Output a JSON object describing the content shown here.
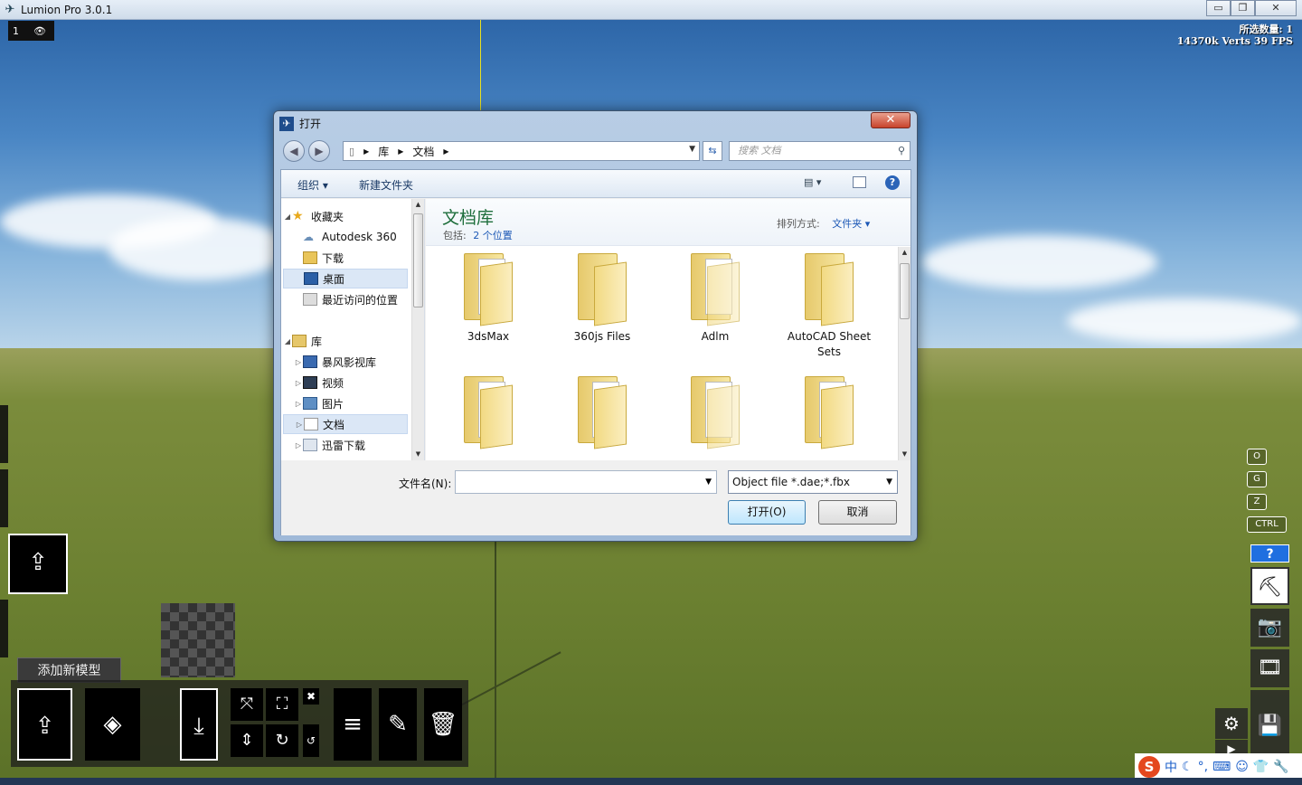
{
  "app": {
    "title": "Lumion Pro  3.0.1",
    "window_buttons": [
      "▭",
      "❐",
      "✕"
    ]
  },
  "viewport": {
    "layer_number": "1",
    "stats_line1": "所选数量: 1",
    "stats_line2": "14370k Verts 39 FPS"
  },
  "dialog": {
    "title": "打开",
    "close_label": "✕",
    "address": {
      "crumbs": [
        "库",
        "文档"
      ]
    },
    "search_placeholder": "搜索 文档",
    "toolbar": {
      "organize": "组织 ▾",
      "new_folder": "新建文件夹"
    },
    "nav": {
      "favorites": "收藏夹",
      "items_fav": [
        "Autodesk 360",
        "下载",
        "桌面",
        "最近访问的位置"
      ],
      "library": "库",
      "items_lib": [
        "暴风影视库",
        "视频",
        "图片",
        "文档",
        "迅雷下载"
      ]
    },
    "library_title": "文档库",
    "includes_label": "包括:",
    "includes_value": "2 个位置",
    "sort_label": "排列方式:",
    "sort_value": "文件夹 ▾",
    "folders": [
      "3dsMax",
      "360js Files",
      "Adlm",
      "AutoCAD Sheet Sets"
    ],
    "filename_label": "文件名(N):",
    "filename_value": "",
    "filetype_value": "Object file *.dae;*.fbx",
    "open_button": "打开(O)",
    "cancel_button": "取消"
  },
  "lumion": {
    "tooltip": "添加新模型",
    "key_hints": [
      "O",
      "G",
      "Z",
      "CTRL"
    ],
    "help": "?"
  },
  "ime": {
    "logo": "S",
    "mode": "中"
  },
  "colors": {
    "accent": "#1c58b6",
    "library_title": "#1e6e3c",
    "help_blue": "#1f6fe0"
  }
}
